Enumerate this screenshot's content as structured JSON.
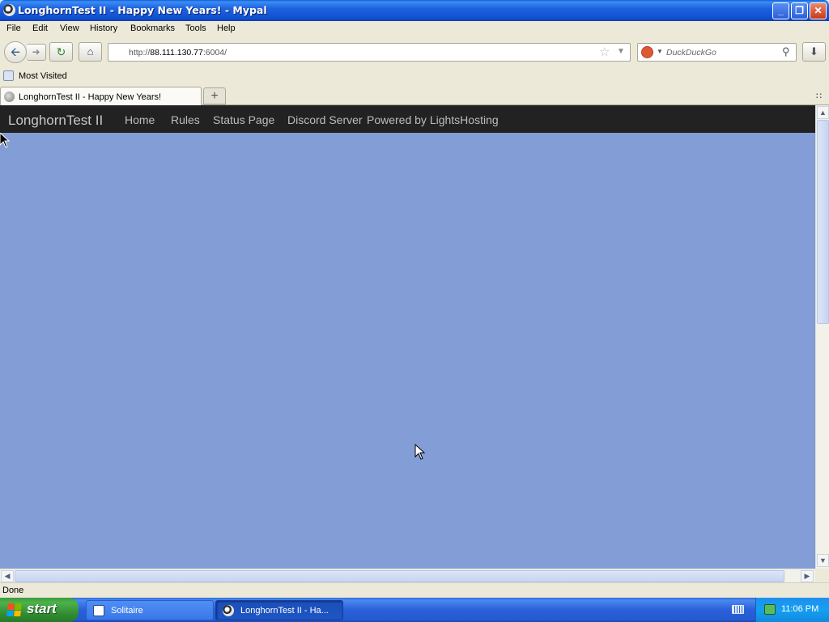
{
  "window": {
    "title": "LonghornTest II - Happy New Years! - Mypal",
    "minimize": "_",
    "maximize": "❐",
    "close": "✕"
  },
  "menu": [
    "File",
    "Edit",
    "View",
    "History",
    "Bookmarks",
    "Tools",
    "Help"
  ],
  "toolbar": {
    "url_prefix": "http://",
    "url_host": "88.111.130.77",
    "url_suffix": ":6004/",
    "search_placeholder": "DuckDuckGo"
  },
  "bookmarks": {
    "label": "Most Visited"
  },
  "tab": {
    "label": "LonghornTest II - Happy New Years!"
  },
  "site": {
    "brand": "LonghornTest II",
    "nav": [
      "Home",
      "Rules",
      "Status Page",
      "Discord Server",
      "Powered by LightsHosting"
    ]
  },
  "status": {
    "text": "Done"
  },
  "taskbar": {
    "start_label": "start",
    "tasks": [
      "Solitaire",
      "LonghornTest II - Ha..."
    ],
    "clock": "11:06 PM"
  },
  "colors": {
    "page_background": "#839dd6",
    "site_nav_background": "#222222",
    "titlebar_blue": "#0f4fd0",
    "start_green": "#3c9a3c"
  },
  "icons": [
    "app-icon",
    "back-arrow-icon",
    "forward-arrow-icon",
    "reload-icon",
    "home-icon",
    "star-icon",
    "duckduckgo-icon",
    "magnifier-icon",
    "download-icon",
    "bookmark-folder-icon",
    "globe-icon",
    "plus-icon",
    "tab-list-icon",
    "windows-flag-icon",
    "keyboard-icon",
    "network-icon",
    "mouse-cursor-icon"
  ]
}
